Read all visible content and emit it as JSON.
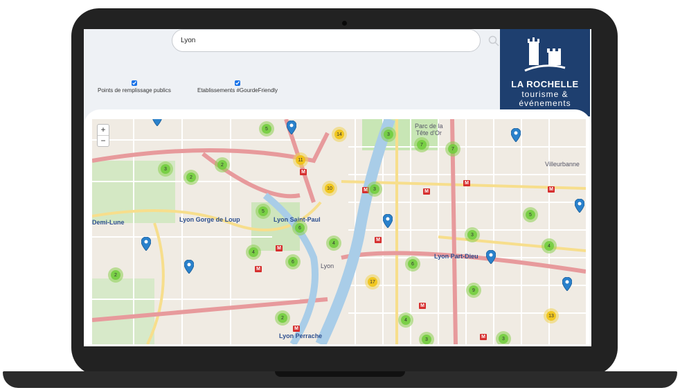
{
  "search": {
    "value": "Lyon"
  },
  "filters": [
    {
      "label": "Points de remplissage publics",
      "checked": true
    },
    {
      "label": "Etablissements #GourdeFriendly",
      "checked": true
    }
  ],
  "brand": {
    "name": "LA ROCHELLE",
    "tagline_line1": "tourisme &",
    "tagline_line2": "événements",
    "color": "#1e3f6f"
  },
  "map": {
    "zoom_in": "+",
    "zoom_out": "−",
    "labels": {
      "parc": "Parc de la\nTête d'Or",
      "villeurbanne": "Villeurbanne",
      "lyon": "Lyon",
      "gorge": "Lyon Gorge de Loup",
      "saint_paul": "Lyon Saint-Paul",
      "part_dieu": "Lyon Part-Dieu",
      "perrache": "Lyon Perrache",
      "demi_lune": "Demi-Lune"
    },
    "clusters": [
      {
        "count": "5",
        "color": "green"
      },
      {
        "count": "14",
        "color": "yellow"
      },
      {
        "count": "3",
        "color": "green"
      },
      {
        "count": "7",
        "color": "green"
      },
      {
        "count": "7",
        "color": "green"
      },
      {
        "count": "11",
        "color": "yellow"
      },
      {
        "count": "3",
        "color": "green"
      },
      {
        "count": "2",
        "color": "green"
      },
      {
        "count": "2",
        "color": "green"
      },
      {
        "count": "10",
        "color": "yellow"
      },
      {
        "count": "3",
        "color": "green"
      },
      {
        "count": "5",
        "color": "green"
      },
      {
        "count": "6",
        "color": "green"
      },
      {
        "count": "4",
        "color": "green"
      },
      {
        "count": "4",
        "color": "green"
      },
      {
        "count": "6",
        "color": "green"
      },
      {
        "count": "5",
        "color": "green"
      },
      {
        "count": "3",
        "color": "green"
      },
      {
        "count": "6",
        "color": "green"
      },
      {
        "count": "4",
        "color": "green"
      },
      {
        "count": "2",
        "color": "green"
      },
      {
        "count": "17",
        "color": "yellow"
      },
      {
        "count": "9",
        "color": "green"
      },
      {
        "count": "2",
        "color": "green"
      },
      {
        "count": "4",
        "color": "green"
      },
      {
        "count": "13",
        "color": "yellow"
      },
      {
        "count": "3",
        "color": "green"
      },
      {
        "count": "3",
        "color": "green"
      }
    ],
    "pin_color": "#2a81cb"
  }
}
